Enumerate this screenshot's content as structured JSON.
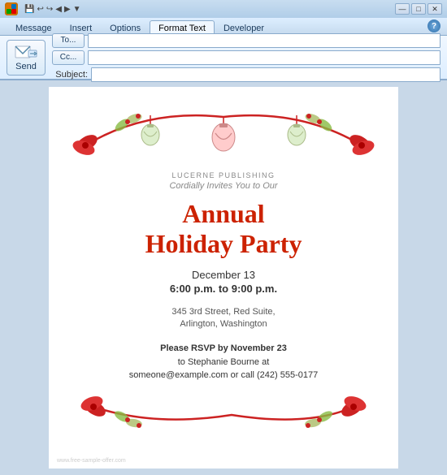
{
  "titlebar": {
    "icon": "O",
    "controls": {
      "minimize": "—",
      "maximize": "□",
      "close": "✕"
    },
    "quickaccess": [
      "💾",
      "↩",
      "↪",
      "◀",
      "▶",
      "▼"
    ]
  },
  "ribbon": {
    "tabs": [
      "Message",
      "Insert",
      "Options",
      "Format Text",
      "Developer"
    ],
    "active_tab": "Message",
    "help_label": "?"
  },
  "toolbar": {
    "send_label": "Send"
  },
  "fields": {
    "to_label": "To...",
    "cc_label": "Cc...",
    "subject_label": "Subject:",
    "to_value": "",
    "cc_value": "",
    "subject_value": ""
  },
  "invitation": {
    "company": "LUCERNE PUBLISHING",
    "cordially": "Cordially Invites You to Our",
    "title_line1": "Annual",
    "title_line2": "Holiday Party",
    "date": "December 13",
    "time": "6:00 p.m. to 9:00 p.m.",
    "address_line1": "345 3rd Street, Red Suite,",
    "address_line2": "Arlington, Washington",
    "rsvp_bold": "Please RSVP by November 23",
    "rsvp_line2": "to Stephanie Bourne at",
    "rsvp_line3": "someone@example.com or call (242) 555-0177"
  },
  "watermark": "www.free-sample-offer.com"
}
